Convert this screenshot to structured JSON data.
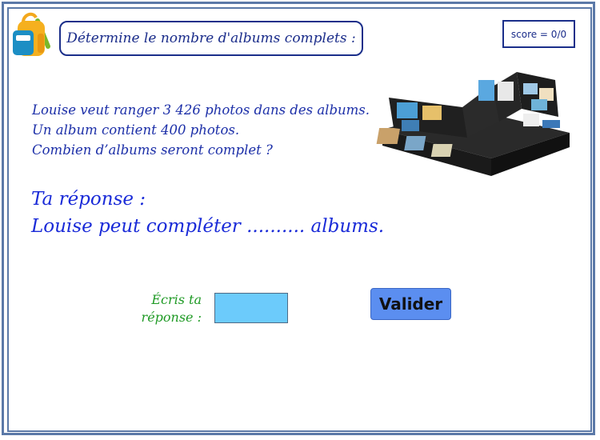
{
  "header": {
    "instruction": "Détermine le nombre d'albums complets :",
    "score": "score = 0/0",
    "backpack_icon": "backpack-icon"
  },
  "problem": {
    "line1": "Louise veut ranger 3 426 photos dans des albums.",
    "line2": "Un album contient 400 photos.",
    "line3": "Combien d’albums seront complet ?"
  },
  "answer": {
    "title": "Ta réponse :",
    "sentence": "Louise peut compléter .......... albums."
  },
  "input": {
    "label_line1": "Écris ta",
    "label_line2": "réponse :",
    "value": ""
  },
  "button": {
    "label": "Valider"
  },
  "colors": {
    "frame": "#5b79a8",
    "text_blue": "#1c2fa8",
    "answer_blue": "#1a2bd8",
    "label_green": "#1f9a25",
    "input_bg": "#6ccbfb",
    "button_bg": "#5b8ef0"
  }
}
